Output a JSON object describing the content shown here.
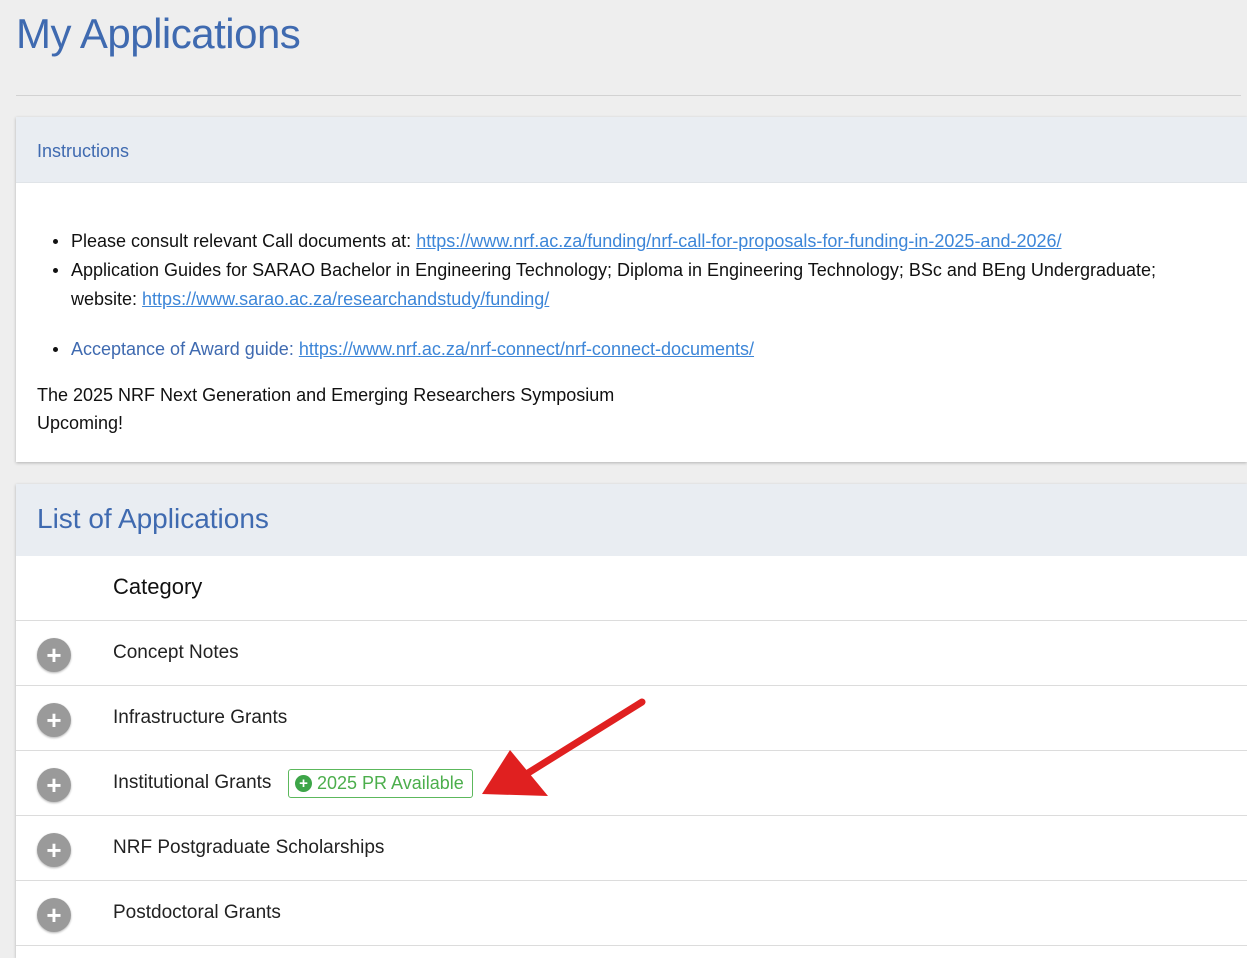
{
  "page": {
    "title": "My Applications"
  },
  "instructions": {
    "heading": "Instructions",
    "items": [
      {
        "text": "Please consult relevant Call documents at: ",
        "link": "https://www.nrf.ac.za/funding/nrf-call-for-proposals-for-funding-in-2025-and-2026/"
      },
      {
        "text": "Application Guides for SARAO Bachelor in Engineering Technology; Diploma in Engineering Technology; BSc and BEng Undergraduate;",
        "text_cont": "website: ",
        "link": "https://www.sarao.ac.za/researchandstudy/funding/"
      },
      {
        "text": "Acceptance of Award guide: ",
        "link": "https://www.nrf.ac.za/nrf-connect/nrf-connect-documents/"
      }
    ],
    "notice_line1": "The 2025 NRF Next Generation and Emerging Researchers Symposium",
    "notice_line2": "Upcoming!"
  },
  "applications": {
    "heading": "List of Applications",
    "column_header": "Category",
    "rows": [
      {
        "label": "Concept Notes"
      },
      {
        "label": "Infrastructure Grants"
      },
      {
        "label": "Institutional Grants",
        "badge": "2025 PR Available"
      },
      {
        "label": "NRF Postgraduate Scholarships"
      },
      {
        "label": "Postdoctoral Grants"
      }
    ]
  },
  "colors": {
    "title_blue": "#3f6ab0",
    "link_blue": "#3d86d8",
    "badge_green": "#4cae4c",
    "arrow_red": "#e02020",
    "expand_gray": "#9a9a9a"
  },
  "icons": {
    "expand": "plus-circle-icon",
    "badge": "plus-circle-icon",
    "annotation": "red-arrow-icon"
  }
}
